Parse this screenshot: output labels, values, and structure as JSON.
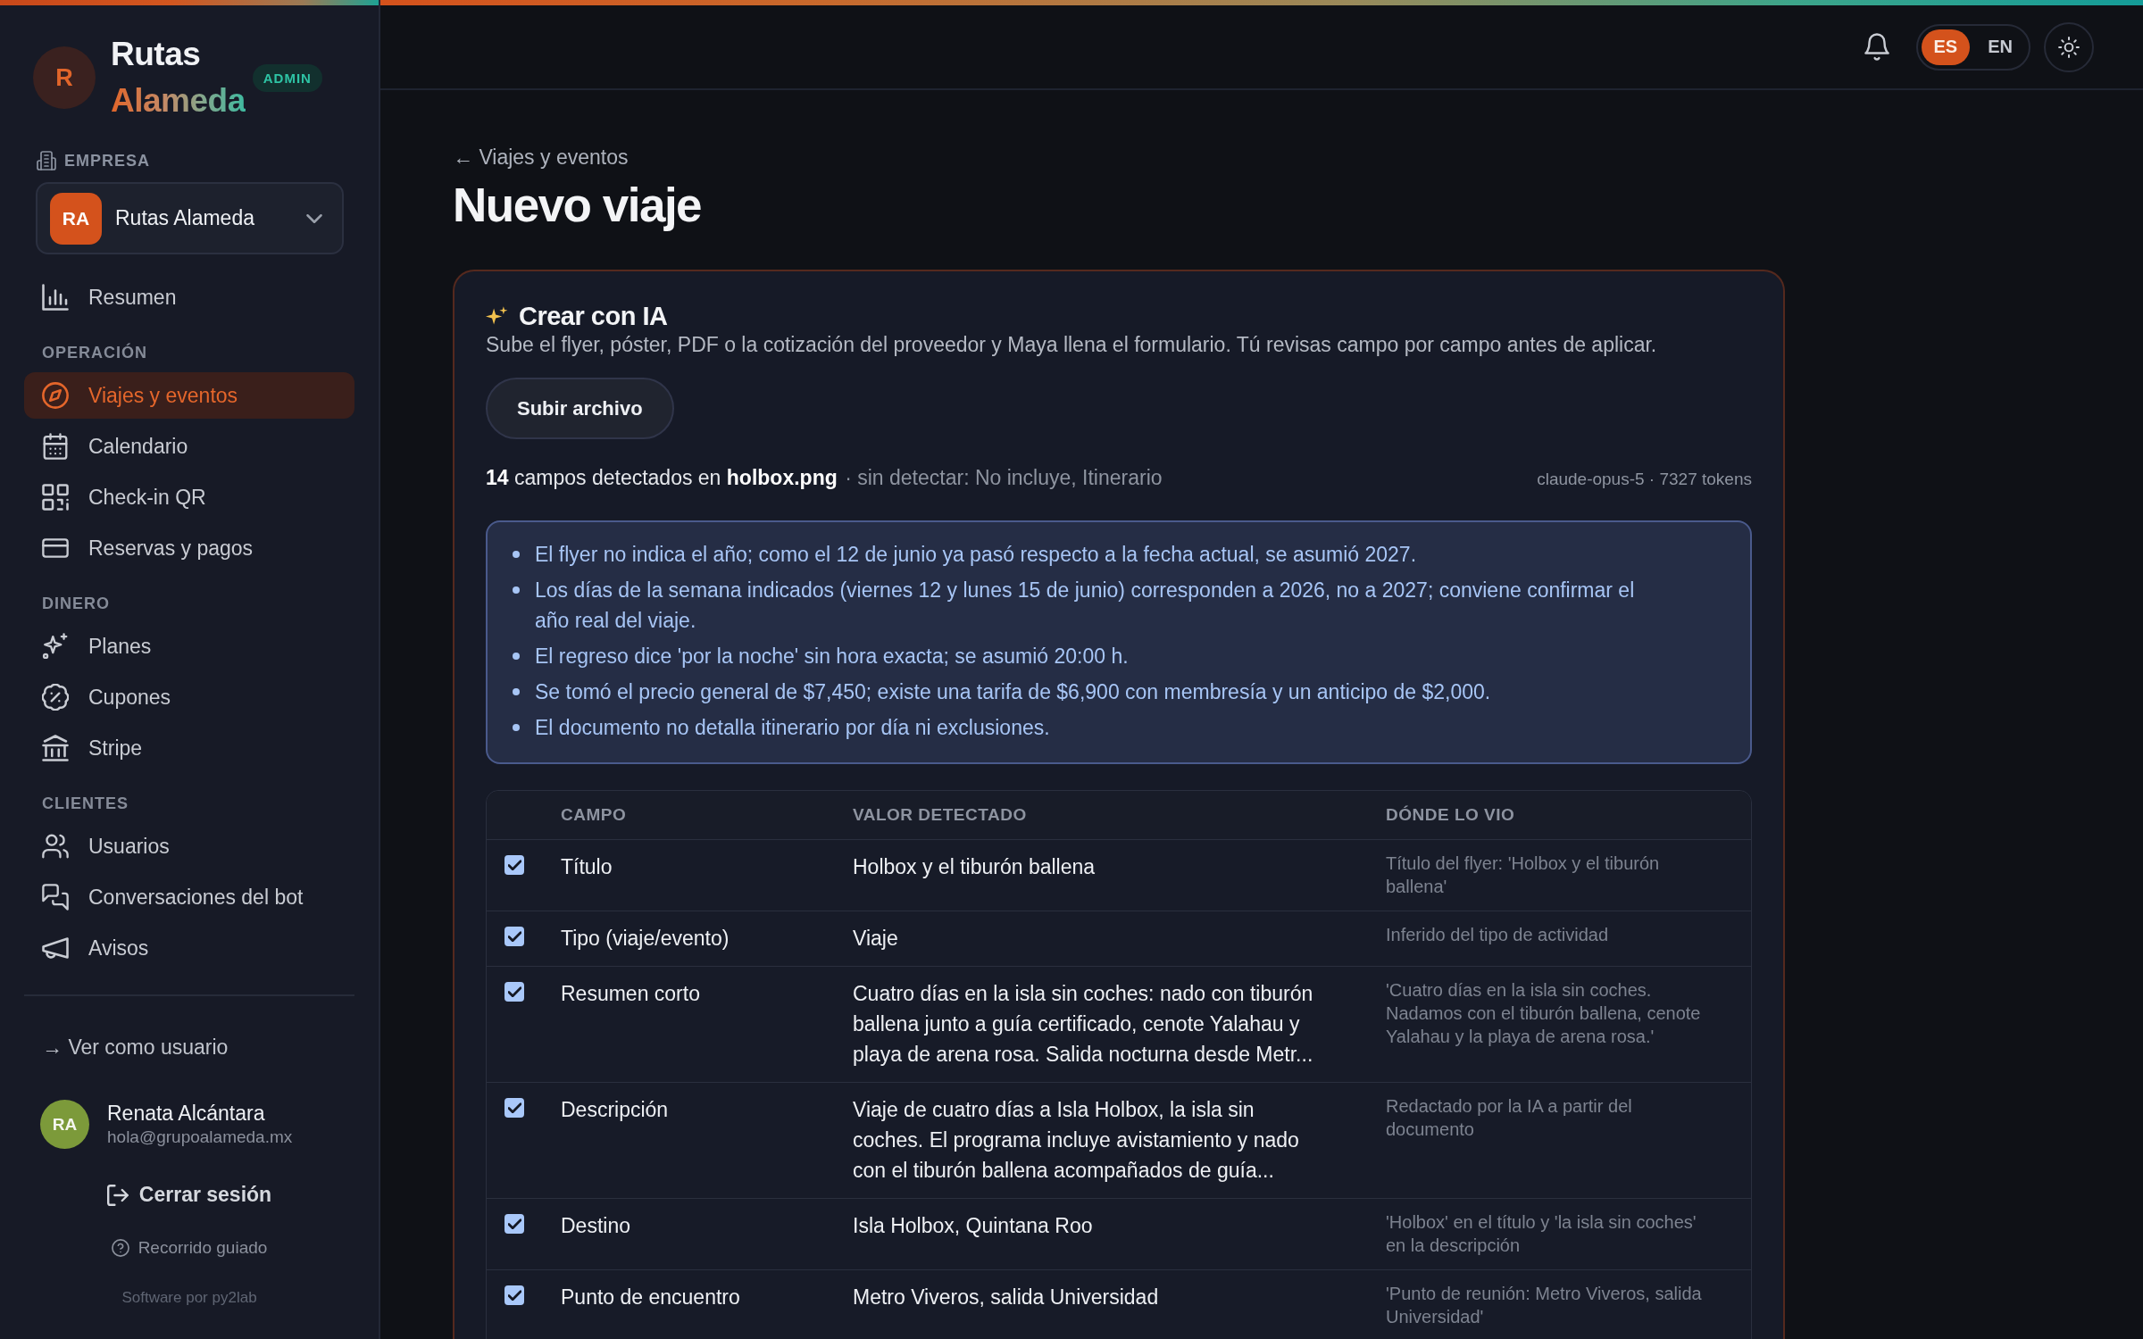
{
  "sidebar": {
    "logo": {
      "initial": "R",
      "name_line_1": "Rutas",
      "name_line_2": "Alameda",
      "badge": "ADMIN"
    },
    "company": {
      "label": "EMPRESA",
      "initials": "RA",
      "name": "Rutas Alameda"
    },
    "nav_sections": [
      {
        "items": [
          {
            "label": "Resumen",
            "selected": false
          }
        ]
      },
      {
        "heading": "OPERACIÓN",
        "items": [
          {
            "label": "Viajes y eventos",
            "selected": true
          },
          {
            "label": "Calendario",
            "selected": false
          },
          {
            "label": "Check-in QR",
            "selected": false
          },
          {
            "label": "Reservas y pagos",
            "selected": false
          }
        ]
      },
      {
        "heading": "DINERO",
        "items": [
          {
            "label": "Planes",
            "selected": false
          },
          {
            "label": "Cupones",
            "selected": false
          },
          {
            "label": "Stripe",
            "selected": false
          }
        ]
      },
      {
        "heading": "CLIENTES",
        "items": [
          {
            "label": "Usuarios",
            "selected": false
          },
          {
            "label": "Conversaciones del bot",
            "selected": false
          },
          {
            "label": "Avisos",
            "selected": false
          }
        ]
      }
    ],
    "view_as_user": "→ Ver como usuario",
    "user": {
      "initials": "RA",
      "name": "Renata Alcántara",
      "email": "hola@grupoalameda.mx"
    },
    "logout": "Cerrar sesión",
    "guided_tour": "Recorrido guiado",
    "credit": "Software por py2lab"
  },
  "header": {
    "languages": [
      {
        "label": "ES",
        "selected": true
      },
      {
        "label": "EN",
        "selected": false
      }
    ]
  },
  "breadcrumb": "← Viajes y eventos",
  "title": "Nuevo viaje",
  "ai_card": {
    "title": "Crear con IA",
    "description": "Sube el flyer, póster, PDF o la cotización del proveedor y Maya llena el formulario. Tú revisas campo por campo antes de aplicar.",
    "upload_button": "Subir archivo",
    "detected_summary": "**14** campos detectados en **holbox.png**",
    "missing_fields": "· sin detectar: No incluye, Itinerario",
    "model_info": "claude-opus-5 · 7327 tokens",
    "notes": [
      "El flyer no indica el año; como el 12 de junio ya pasó respecto a la fecha actual, se asumió 2027.",
      "Los días de la semana indicados (viernes 12 y lunes 15 de junio) corresponden a 2026, no a 2027; conviene confirmar el año real del viaje.",
      "El regreso dice 'por la noche' sin hora exacta; se asumió 20:00 h.",
      "Se tomó el precio general de $7,450; existe una tarifa de $6,900 con membresía y un anticipo de $2,000.",
      "El documento no detalla itinerario por día ni exclusiones."
    ],
    "table": {
      "columns": [
        "CAMPO",
        "VALOR DETECTADO",
        "DÓNDE LO VIO"
      ],
      "rows": [
        {
          "checked": true,
          "field": "Título",
          "value": "Holbox y el tiburón ballena",
          "source": "Título del flyer: 'Holbox y el tiburón ballena'"
        },
        {
          "checked": true,
          "field": "Tipo (viaje/evento)",
          "value": "Viaje",
          "source": "Inferido del tipo de actividad"
        },
        {
          "checked": true,
          "field": "Resumen corto",
          "value": "Cuatro días en la isla sin coches: nado con tiburón ballena junto a guía certificado, cenote Yalahau y playa de arena rosa. Salida nocturna desde Metr...",
          "source": "'Cuatro días en la isla sin coches. Nadamos con el tiburón ballena, cenote Yalahau y la playa de arena rosa.'"
        },
        {
          "checked": true,
          "field": "Descripción",
          "value": "Viaje de cuatro días a Isla Holbox, la isla sin coches. El programa incluye avistamiento y nado con el tiburón ballena acompañados de guía...",
          "source": "Redactado por la IA a partir del documento"
        },
        {
          "checked": true,
          "field": "Destino",
          "value": "Isla Holbox, Quintana Roo",
          "source": "'Holbox' en el título y 'la isla sin coches' en la descripción"
        },
        {
          "checked": true,
          "field": "Punto de encuentro",
          "value": "Metro Viveros, salida Universidad",
          "source": "'Punto de reunión: Metro Viveros, salida Universidad'"
        }
      ]
    }
  }
}
